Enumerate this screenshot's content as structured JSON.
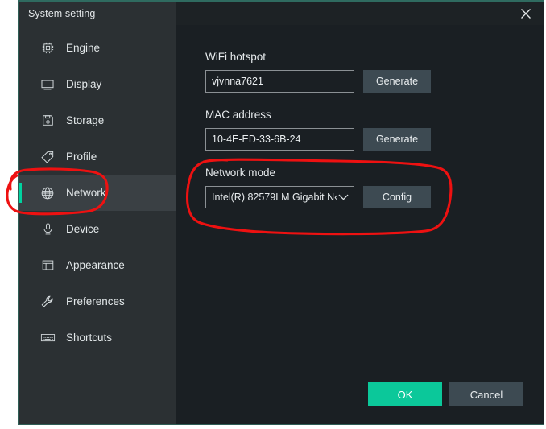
{
  "window": {
    "title": "System setting",
    "close_icon": "close-icon",
    "accent_color": "#00d3a0",
    "sidebar_bg": "#2b3033",
    "content_bg": "#1a1f23"
  },
  "sidebar": {
    "items": [
      {
        "label": "Engine",
        "icon": "cpu-chip-icon",
        "selected": false
      },
      {
        "label": "Display",
        "icon": "monitor-icon",
        "selected": false
      },
      {
        "label": "Storage",
        "icon": "floppy-disk-icon",
        "selected": false
      },
      {
        "label": "Profile",
        "icon": "tag-icon",
        "selected": false
      },
      {
        "label": "Network",
        "icon": "globe-icon",
        "selected": true
      },
      {
        "label": "Device",
        "icon": "microphone-icon",
        "selected": false
      },
      {
        "label": "Appearance",
        "icon": "window-icon",
        "selected": false
      },
      {
        "label": "Preferences",
        "icon": "wrench-icon",
        "selected": false
      },
      {
        "label": "Shortcuts",
        "icon": "keyboard-icon",
        "selected": false
      }
    ]
  },
  "main": {
    "wifi_hotspot": {
      "label": "WiFi hotspot",
      "value": "vjvnna7621",
      "placeholder": "",
      "button_label": "Generate"
    },
    "mac_address": {
      "label": "MAC address",
      "value": "10-4E-ED-33-6B-24",
      "placeholder": "",
      "button_label": "Generate"
    },
    "network_mode": {
      "label": "Network mode",
      "selected_option": "Intel(R) 82579LM Gigabit N‹",
      "chevron_icon": "chevron-down-icon",
      "button_label": "Config"
    }
  },
  "footer": {
    "ok_label": "OK",
    "cancel_label": "Cancel",
    "ok_color": "#0bc89a",
    "cancel_color": "#3d4a52"
  },
  "annotations": {
    "color": "#ee1111",
    "shapes": [
      {
        "name": "circle-around-network-sidebar-item"
      },
      {
        "name": "circle-around-network-mode-section"
      }
    ]
  }
}
